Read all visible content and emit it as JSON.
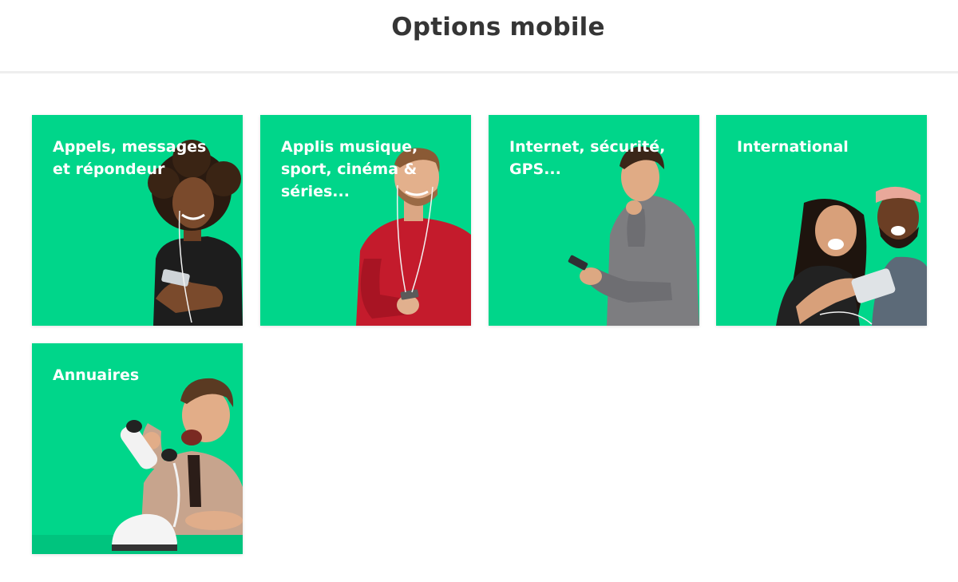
{
  "header": {
    "title": "Options mobile"
  },
  "colors": {
    "tile_bg": "#00d68a",
    "title_text": "#353535",
    "tile_text": "#ffffff"
  },
  "tiles": [
    {
      "label": "Appels, messages\net répondeur",
      "image": "woman-curly-hair-phone-earphones"
    },
    {
      "label": "Applis musique,\nsport, cinéma &\nséries...",
      "image": "man-red-sweater-earphones"
    },
    {
      "label": "Internet, sécurité,\nGPS...",
      "image": "man-grey-sweater-phone"
    },
    {
      "label": "International",
      "image": "couple-selfie"
    },
    {
      "label": "Annuaires",
      "image": "man-shouting-retro-phone"
    }
  ]
}
